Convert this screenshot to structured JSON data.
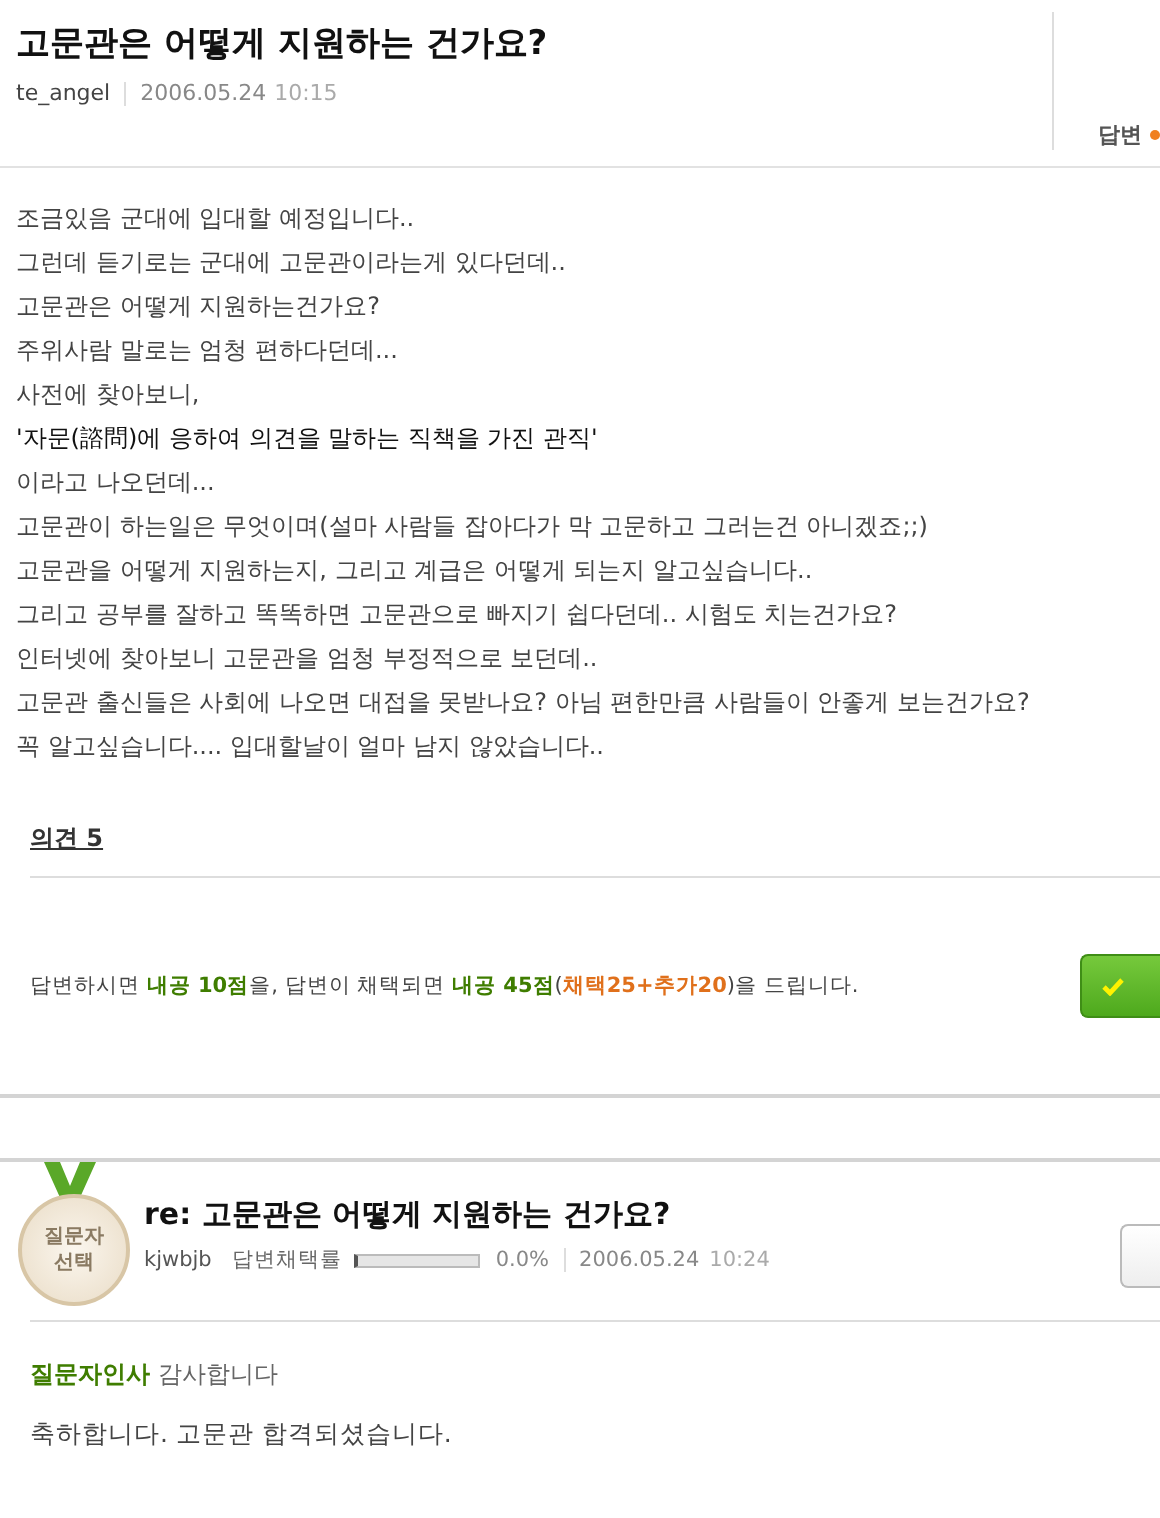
{
  "question": {
    "title": "고문관은 어떻게 지원하는 건가요?",
    "author": "te_angel",
    "date": "2006.05.24",
    "time": "10:15",
    "side_label": "답변",
    "body": [
      {
        "kind": "plain",
        "text": "조금있음 군대에 입대할 예정입니다.."
      },
      {
        "kind": "plain",
        "text": "그런데 듣기로는 군대에 고문관이라는게 있다던데.."
      },
      {
        "kind": "plain",
        "text": "고문관은 어떻게 지원하는건가요?"
      },
      {
        "kind": "plain",
        "text": "주위사람 말로는 엄청 편하다던데..."
      },
      {
        "kind": "plain",
        "text": "사전에 찾아보니,"
      },
      {
        "kind": "emphasis",
        "text": "'자문(諮問)에 응하여 의견을 말하는 직책을 가진 관직'"
      },
      {
        "kind": "plain",
        "text": "이라고 나오던데..."
      },
      {
        "kind": "plain",
        "text": "고문관이 하는일은 무엇이며(설마 사람들 잡아다가 막 고문하고 그러는건 아니겠죠;;)"
      },
      {
        "kind": "plain",
        "text": "고문관을 어떻게 지원하는지, 그리고 계급은 어떻게 되는지 알고싶습니다.."
      },
      {
        "kind": "plain",
        "text": "그리고 공부를 잘하고 똑똑하면 고문관으로 빠지기 쉽다던데.. 시험도 치는건가요?"
      },
      {
        "kind": "plain",
        "text": "인터넷에 찾아보니 고문관을 엄청 부정적으로 보던데.."
      },
      {
        "kind": "plain",
        "text": "고문관 출신들은 사회에 나오면 대접을 못받나요? 아님 편한만큼 사람들이 안좋게 보는건가요?"
      },
      {
        "kind": "plain",
        "text": "꼭 알고싶습니다.... 입대할날이 얼마 남지 않았습니다.."
      }
    ],
    "opinions_link": "의견 5",
    "reward": [
      {
        "kind": "plain",
        "text": "답변하시면 "
      },
      {
        "kind": "green",
        "text": "내공 10점"
      },
      {
        "kind": "plain",
        "text": "을, 답변이 채택되면 "
      },
      {
        "kind": "green",
        "text": "내공 45점"
      },
      {
        "kind": "plain",
        "text": "("
      },
      {
        "kind": "orange",
        "text": "채택25+추가20"
      },
      {
        "kind": "plain",
        "text": ")을 드립니다."
      }
    ]
  },
  "answer": {
    "badge": [
      "질문자",
      "선택"
    ],
    "title": "re: 고문관은 어떻게 지원하는 건가요?",
    "author": "kjwbjb",
    "rate_label": "답변채택률",
    "level": 0.0,
    "rate": "0.0%",
    "date": "2006.05.24",
    "time": "10:24",
    "greeting_label": "질문자인사",
    "greeting": "감사합니다",
    "body": "축하합니다. 고문관 합격되셨습니다."
  }
}
